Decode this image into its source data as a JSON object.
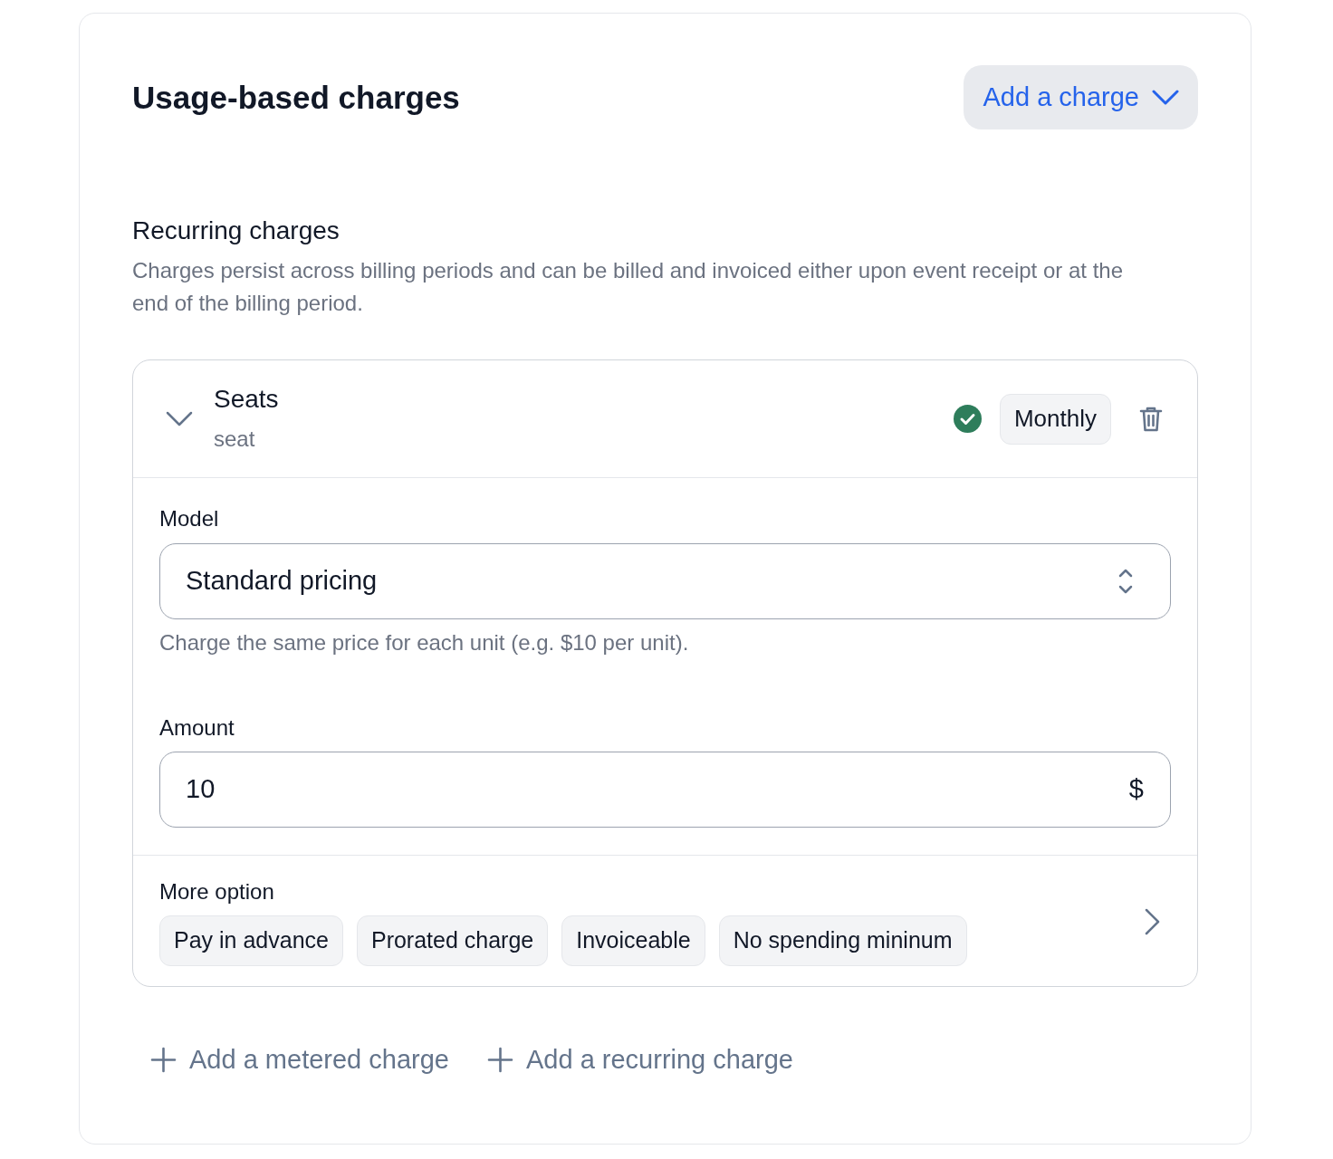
{
  "card": {
    "title": "Usage-based charges",
    "add_button": {
      "label": "Add a charge"
    }
  },
  "section": {
    "title": "Recurring charges",
    "description": "Charges persist across billing periods and can be billed and invoiced either upon event receipt or at the end of the billing period."
  },
  "charges": [
    {
      "name": "Seats",
      "unit": "seat",
      "expanded": true,
      "period": "Monthly",
      "model": {
        "label": "Model",
        "value": "Standard pricing",
        "hint": "Charge the same price for each unit (e.g. $10 per unit)."
      },
      "amount": {
        "label": "Amount",
        "value": "10",
        "currency": "$"
      },
      "more_options": {
        "label": "More option",
        "chips": [
          "Pay in advance",
          "Prorated charge",
          "Invoiceable",
          "No spending mininum"
        ]
      }
    }
  ],
  "actions": [
    {
      "label": "Add a metered charge"
    },
    {
      "label": "Add a recurring charge"
    }
  ]
}
